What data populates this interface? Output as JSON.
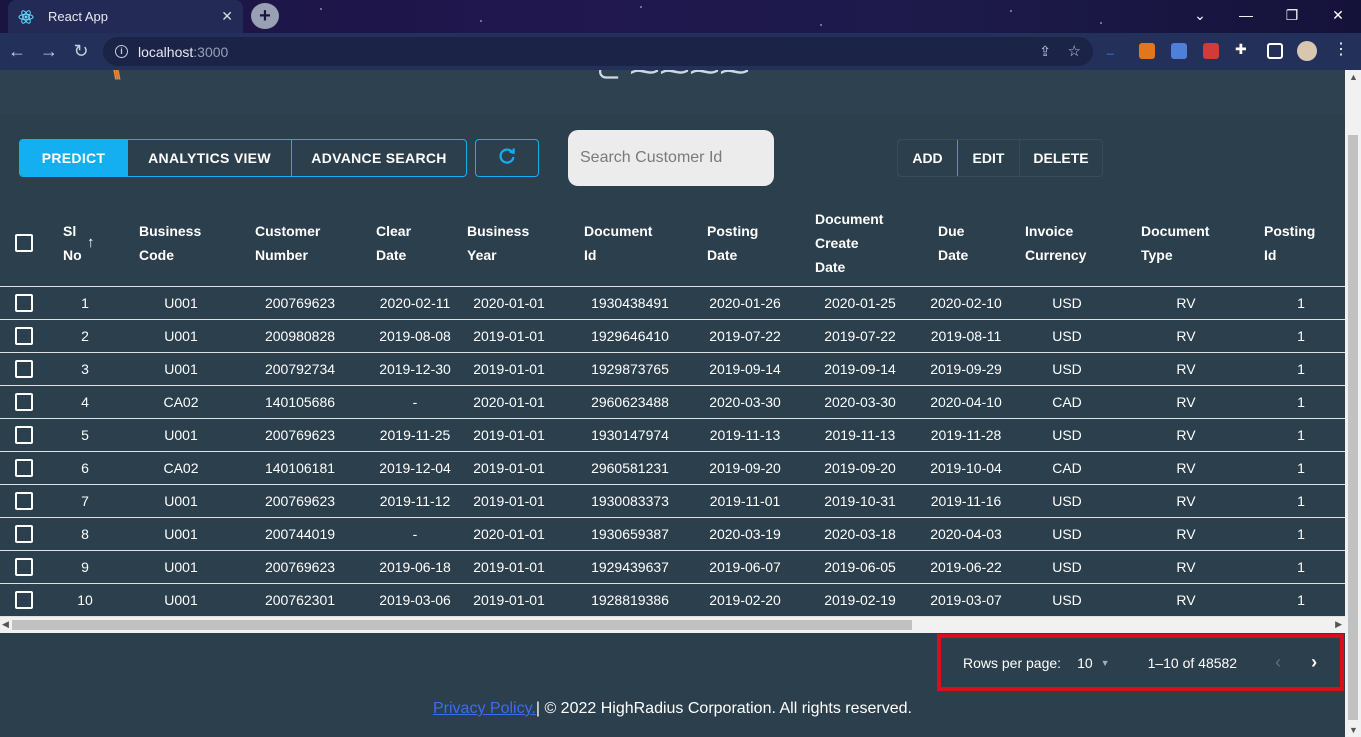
{
  "browser": {
    "tab_title": "React App",
    "url_host": "localhost",
    "url_port": ":3000"
  },
  "toolbar": {
    "mode_buttons": [
      "PREDICT",
      "ANALYTICS VIEW",
      "ADVANCE SEARCH"
    ],
    "search_placeholder": "Search Customer Id",
    "crud_buttons": [
      "ADD",
      "EDIT",
      "DELETE"
    ]
  },
  "table": {
    "columns": [
      "Sl\nNo",
      "Business\nCode",
      "Customer\nNumber",
      "Clear\nDate",
      "Business\nYear",
      "Document\nId",
      "Posting\nDate",
      "Document\nCreate\nDate",
      "Due\nDate",
      "Invoice\nCurrency",
      "Document\nType",
      "Posting\nId"
    ],
    "rows": [
      [
        "1",
        "U001",
        "200769623",
        "2020-02-11",
        "2020-01-01",
        "1930438491",
        "2020-01-26",
        "2020-01-25",
        "2020-02-10",
        "USD",
        "RV",
        "1"
      ],
      [
        "2",
        "U001",
        "200980828",
        "2019-08-08",
        "2019-01-01",
        "1929646410",
        "2019-07-22",
        "2019-07-22",
        "2019-08-11",
        "USD",
        "RV",
        "1"
      ],
      [
        "3",
        "U001",
        "200792734",
        "2019-12-30",
        "2019-01-01",
        "1929873765",
        "2019-09-14",
        "2019-09-14",
        "2019-09-29",
        "USD",
        "RV",
        "1"
      ],
      [
        "4",
        "CA02",
        "140105686",
        "-",
        "2020-01-01",
        "2960623488",
        "2020-03-30",
        "2020-03-30",
        "2020-04-10",
        "CAD",
        "RV",
        "1"
      ],
      [
        "5",
        "U001",
        "200769623",
        "2019-11-25",
        "2019-01-01",
        "1930147974",
        "2019-11-13",
        "2019-11-13",
        "2019-11-28",
        "USD",
        "RV",
        "1"
      ],
      [
        "6",
        "CA02",
        "140106181",
        "2019-12-04",
        "2019-01-01",
        "2960581231",
        "2019-09-20",
        "2019-09-20",
        "2019-10-04",
        "CAD",
        "RV",
        "1"
      ],
      [
        "7",
        "U001",
        "200769623",
        "2019-11-12",
        "2019-01-01",
        "1930083373",
        "2019-11-01",
        "2019-10-31",
        "2019-11-16",
        "USD",
        "RV",
        "1"
      ],
      [
        "8",
        "U001",
        "200744019",
        "-",
        "2020-01-01",
        "1930659387",
        "2020-03-19",
        "2020-03-18",
        "2020-04-03",
        "USD",
        "RV",
        "1"
      ],
      [
        "9",
        "U001",
        "200769623",
        "2019-06-18",
        "2019-01-01",
        "1929439637",
        "2019-06-07",
        "2019-06-05",
        "2019-06-22",
        "USD",
        "RV",
        "1"
      ],
      [
        "10",
        "U001",
        "200762301",
        "2019-03-06",
        "2019-01-01",
        "1928819386",
        "2019-02-20",
        "2019-02-19",
        "2019-03-07",
        "USD",
        "RV",
        "1"
      ]
    ]
  },
  "pagination": {
    "rows_per_page_label": "Rows per page:",
    "rows_per_page": "10",
    "range": "1–10 of 48582"
  },
  "footer": {
    "privacy_link": "Privacy Policy.",
    "copyright": "| © 2022 HighRadius Corporation. All rights reserved."
  },
  "colors": {
    "accent": "#14aff1",
    "background": "#2b3f4c",
    "highlight_box": "#d8101c"
  }
}
